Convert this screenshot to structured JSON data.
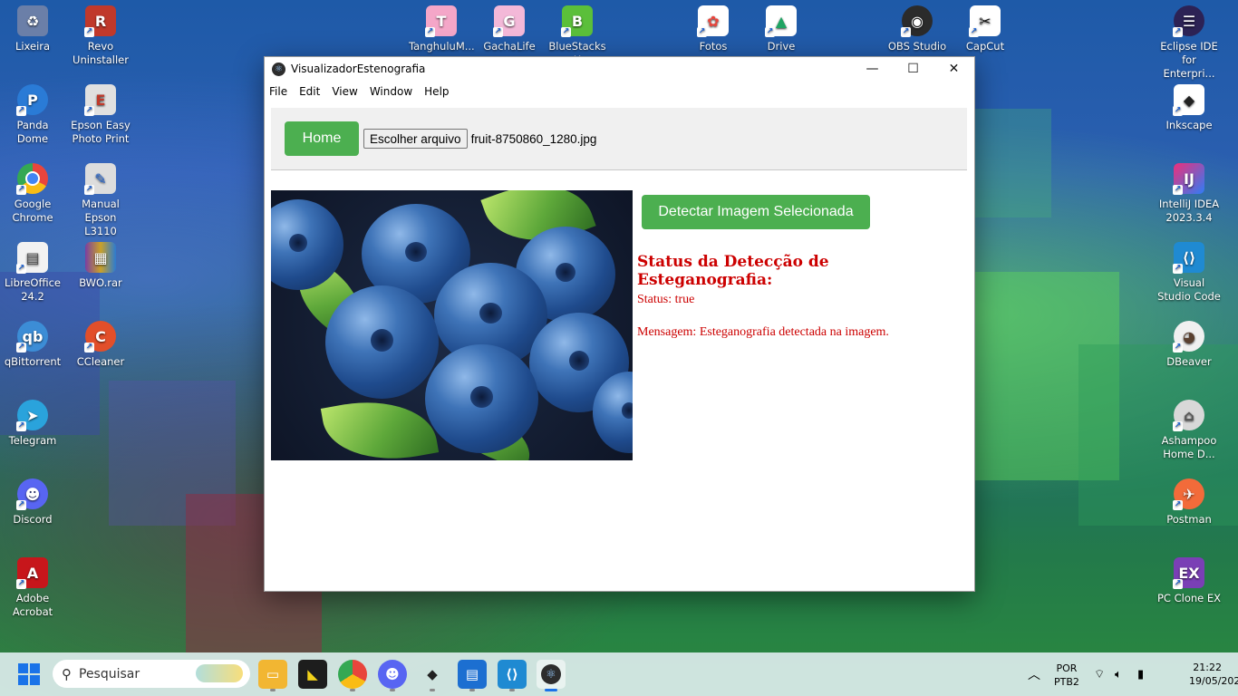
{
  "desktop": {
    "icons": [
      {
        "label": "Lixeira",
        "color": "#6b7fa8"
      },
      {
        "label": "Revo Uninstaller",
        "color": "#c0392b"
      },
      {
        "label": "TanghuluM...",
        "color": "#f4a6c8"
      },
      {
        "label": "GachaLife",
        "color": "#f3b8d8"
      },
      {
        "label": "BlueStacks X",
        "color": "#5bbf3a"
      },
      {
        "label": "Fotos",
        "color": "#ffffff"
      },
      {
        "label": "Drive",
        "color": "#ffffff"
      },
      {
        "label": "OBS Studio",
        "color": "#2b2b2b"
      },
      {
        "label": "CapCut",
        "color": "#111111"
      },
      {
        "label": "Eclipse IDE for Enterpri...",
        "color": "#2c2255"
      },
      {
        "label": "Panda Dome",
        "color": "#2a7bd6"
      },
      {
        "label": "Epson Easy Photo Print",
        "color": "#e0e0e0"
      },
      {
        "label": "Inkscape",
        "color": "#222222"
      },
      {
        "label": "Google Chrome",
        "color": "#e8453c"
      },
      {
        "label": "Manual Epson L3110",
        "color": "#dddddd"
      },
      {
        "label": "IntelliJ IDEA 2023.3.4",
        "color": "#ee2f7a"
      },
      {
        "label": "LibreOffice 24.2",
        "color": "#f2f2f2"
      },
      {
        "label": "BWO.rar",
        "color": "#7b3fa0"
      },
      {
        "label": "Visual Studio Code",
        "color": "#1f8ad2"
      },
      {
        "label": "qBittorrent",
        "color": "#3c8dd6"
      },
      {
        "label": "CCleaner",
        "color": "#e24f2a"
      },
      {
        "label": "DBeaver",
        "color": "#f0f0f0"
      },
      {
        "label": "Telegram",
        "color": "#2aa3dc"
      },
      {
        "label": "Ashampoo Home D...",
        "color": "#d8d8d8"
      },
      {
        "label": "Discord",
        "color": "#5865f2"
      },
      {
        "label": "Postman",
        "color": "#f26b3a"
      },
      {
        "label": "Adobe Acrobat",
        "color": "#c7161b"
      },
      {
        "label": "PC Clone EX",
        "color": "#7a3fb5"
      }
    ]
  },
  "window": {
    "title": "VisualizadorEstenografia",
    "menu": [
      "File",
      "Edit",
      "View",
      "Window",
      "Help"
    ],
    "controls": {
      "minimize": "—",
      "maximize": "☐",
      "close": "✕"
    }
  },
  "app": {
    "home_label": "Home",
    "file_button_label": "Escolher arquivo",
    "file_name": "fruit-8750860_1280.jpg",
    "detect_label": "Detectar Imagem Selecionada",
    "status_title": "Status da Detecção de Esteganografia:",
    "status_text": "Status: true",
    "message_text": "Mensagem: Esteganografia detectada na imagem.",
    "accent_color": "#4caf50",
    "status_color": "#cc0000"
  },
  "taskbar": {
    "search_placeholder": "Pesquisar",
    "language": "POR",
    "layout": "PTB2",
    "time": "21:22",
    "date": "19/05/2024"
  }
}
